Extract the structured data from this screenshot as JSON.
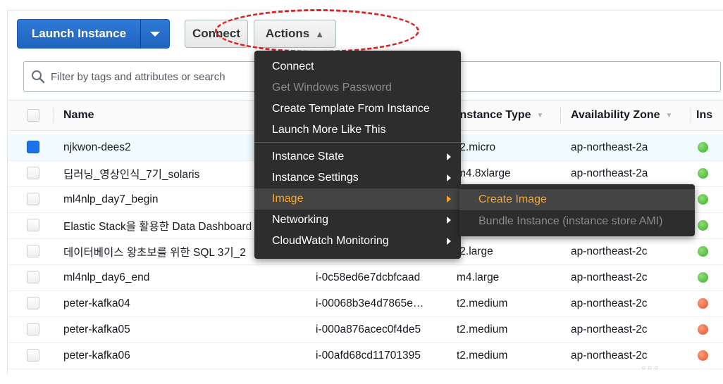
{
  "toolbar": {
    "launch_label": "Launch Instance",
    "connect_label": "Connect",
    "actions_label": "Actions",
    "actions_caret": "^"
  },
  "search": {
    "placeholder": "Filter by tags and attributes or search"
  },
  "table": {
    "headers": {
      "name": "Name",
      "instance_type": "Instance Type",
      "availability_zone": "Availability Zone",
      "state": "Ins"
    },
    "rows": [
      {
        "name": "njkwon-dees2",
        "instance_id": "",
        "type": "t2.micro",
        "zone": "ap-northeast-2a",
        "status": "green",
        "selected": true
      },
      {
        "name": "딥러닝_영상인식_7기_solaris",
        "instance_id": "",
        "type": "m4.8xlarge",
        "zone": "ap-northeast-2a",
        "status": "green",
        "selected": false
      },
      {
        "name": "ml4nlp_day7_begin",
        "instance_id": "",
        "type": "",
        "zone": "",
        "status": "green",
        "selected": false
      },
      {
        "name": "Elastic Stack을 활용한 Data Dashboard",
        "instance_id": "",
        "type": "",
        "zone": "",
        "status": "green",
        "selected": false
      },
      {
        "name": "데이터베이스 왕초보를 위한 SQL 3기_2",
        "instance_id": "",
        "type": "t2.large",
        "zone": "ap-northeast-2c",
        "status": "green",
        "selected": false
      },
      {
        "name": "ml4nlp_day6_end",
        "instance_id": "i-0c58ed6e7dcbfcaad",
        "type": "m4.large",
        "zone": "ap-northeast-2c",
        "status": "green",
        "selected": false
      },
      {
        "name": "peter-kafka04",
        "instance_id": "i-00068b3e4d7865e…",
        "type": "t2.medium",
        "zone": "ap-northeast-2c",
        "status": "red",
        "selected": false
      },
      {
        "name": "peter-kafka05",
        "instance_id": "i-000a876acec0f4de5",
        "type": "t2.medium",
        "zone": "ap-northeast-2c",
        "status": "red",
        "selected": false
      },
      {
        "name": "peter-kafka06",
        "instance_id": "i-00afd68cd11701395",
        "type": "t2.medium",
        "zone": "ap-northeast-2c",
        "status": "red",
        "selected": false
      }
    ]
  },
  "actions_menu": {
    "items": [
      {
        "label": "Connect",
        "disabled": false
      },
      {
        "label": "Get Windows Password",
        "disabled": true
      },
      {
        "label": "Create Template From Instance",
        "disabled": false
      },
      {
        "label": "Launch More Like This",
        "disabled": false
      },
      {
        "label": "Instance State",
        "submenu": true
      },
      {
        "label": "Instance Settings",
        "submenu": true
      },
      {
        "label": "Image",
        "submenu": true,
        "active": true
      },
      {
        "label": "Networking",
        "submenu": true
      },
      {
        "label": "CloudWatch Monitoring",
        "submenu": true
      }
    ]
  },
  "image_submenu": {
    "items": [
      {
        "label": "Create Image",
        "active": true
      },
      {
        "label": "Bundle Instance (instance store AMI)",
        "disabled": true
      }
    ]
  },
  "colors": {
    "primary": "#1f63bd",
    "menu_bg": "#2d2d2d",
    "menu_highlight": "#f7a62b",
    "annotation": "#e02020",
    "status_running": "#3fae2a",
    "status_stopped": "#e0562c"
  }
}
